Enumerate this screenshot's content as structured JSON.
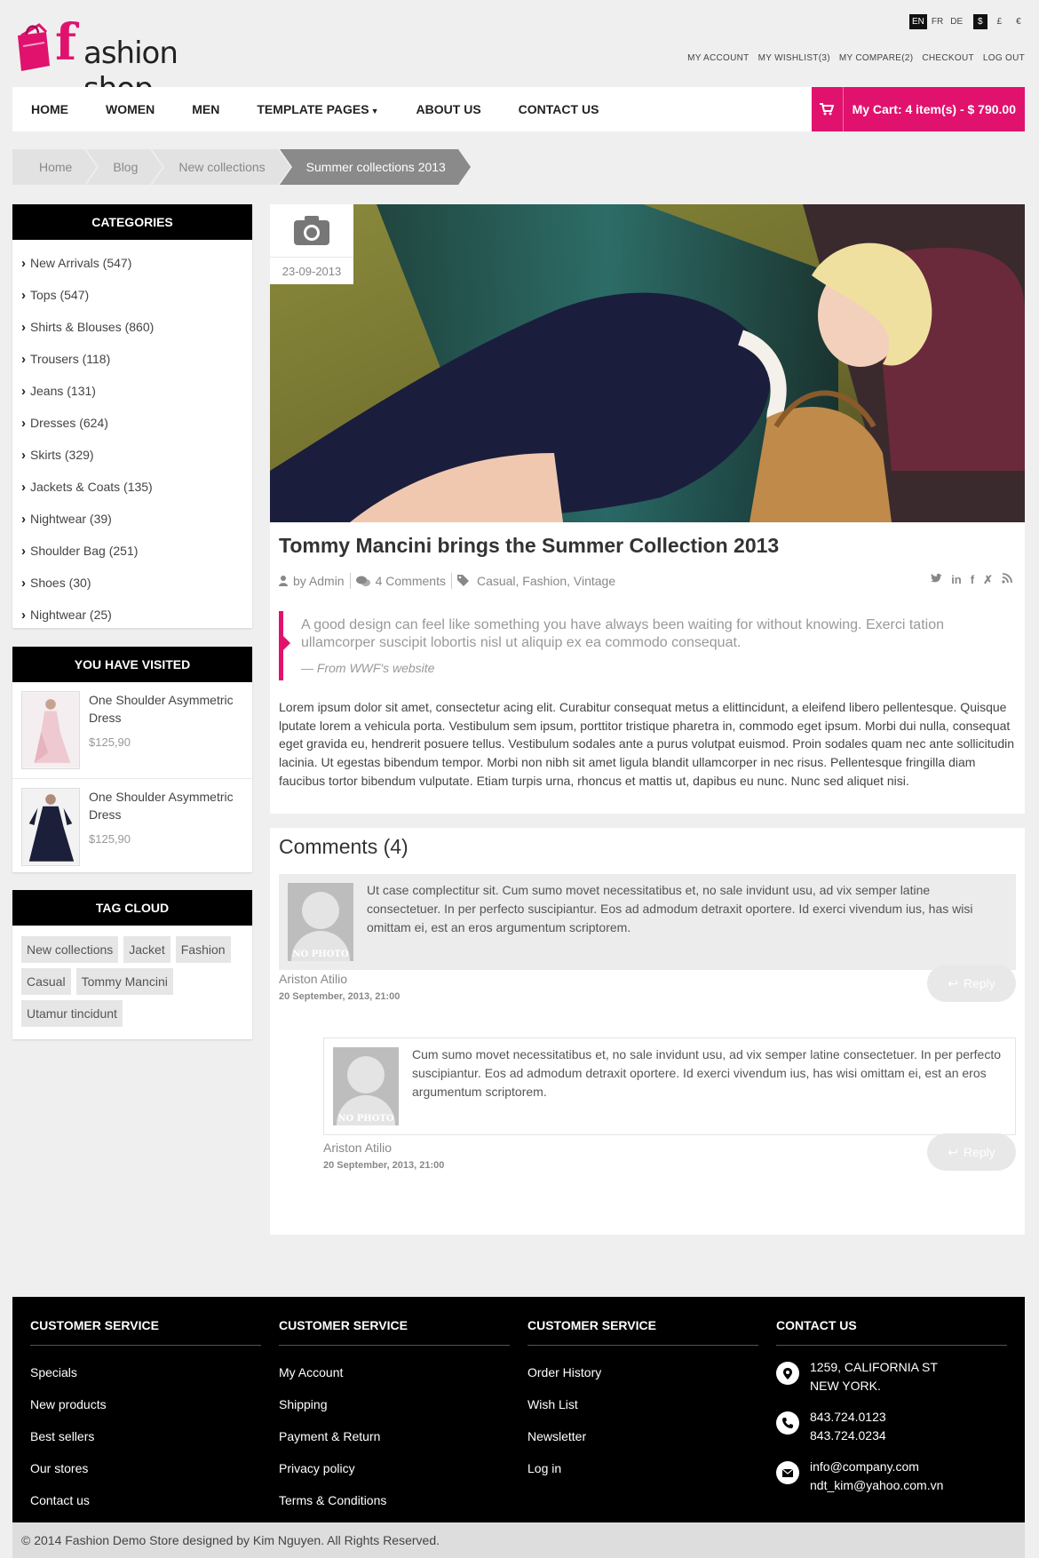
{
  "brand": {
    "logo_letter": "f",
    "logo_text": "ashion shop"
  },
  "languages": [
    "EN",
    "FR",
    "DE"
  ],
  "currencies": [
    "$",
    "£",
    "€"
  ],
  "top_links": [
    "MY ACCOUNT",
    "MY WISHLIST(3)",
    "MY COMPARE(2)",
    "CHECKOUT",
    "LOG OUT"
  ],
  "nav": {
    "items": [
      "HOME",
      "WOMEN",
      "MEN",
      "TEMPLATE PAGES",
      "ABOUT US",
      "CONTACT US"
    ],
    "cart_label": "My Cart: 4 item(s) - $ 790.00"
  },
  "breadcrumb": [
    "Home",
    "Blog",
    "New collections",
    "Summer collections 2013"
  ],
  "categories": {
    "title": "CATEGORIES",
    "items": [
      "New Arrivals (547)",
      "Tops (547)",
      "Shirts & Blouses (860)",
      "Trousers (118)",
      "Jeans (131)",
      "Dresses (624)",
      "Skirts (329)",
      "Jackets & Coats (135)",
      "Nightwear (39)",
      "Shoulder Bag (251)",
      "Shoes (30)",
      "Nightwear (25)"
    ]
  },
  "visited": {
    "title": "YOU HAVE VISITED",
    "items": [
      {
        "name": "One Shoulder Asymmetric Dress",
        "price": "$125,90"
      },
      {
        "name": "One Shoulder Asymmetric Dress",
        "price": "$125,90"
      }
    ]
  },
  "tag_cloud": {
    "title": "TAG CLOUD",
    "tags": [
      "New collections",
      "Jacket",
      "Fashion",
      "Casual",
      "Tommy Mancini",
      "Utamur tincidunt"
    ]
  },
  "post": {
    "date": "23-09-2013",
    "title": "Tommy Mancini brings the Summer Collection 2013",
    "author": "by Admin",
    "comments": "4 Comments",
    "tags": "Casual, Fashion, Vintage",
    "share_icons": [
      "twitter-icon",
      "linkedin-icon",
      "facebook-icon",
      "xing-icon",
      "rss-icon"
    ],
    "quote": "A good design can feel like something you have always been waiting for without knowing. Exerci tation ullamcorper suscipit lobortis nisl ut aliquip ex ea commodo consequat.",
    "quote_source": "— From WWF's website",
    "body": "Lorem ipsum dolor sit amet, consectetur acing elit. Curabitur consequat metus a elittincidunt, a eleifend libero pellentesque. Quisque lputate lorem a vehicula porta. Vestibulum sem ipsum, porttitor tristique pharetra in, commodo eget ipsum. Morbi dui nulla, consequat eget gravida eu, hendrerit posuere tellus. Vestibulum sodales ante a purus volutpat euismod. Proin sodales quam nec ante sollicitudin lacinia. Ut egestas bibendum tempor. Morbi non nibh sit amet ligula blandit ullamcorper in nec risus. Pellentesque fringilla diam faucibus tortor bibendum vulputate. Etiam turpis urna, rhoncus et mattis ut, dapibus eu nunc. Nunc sed aliquet nisi."
  },
  "comments": {
    "title": "Comments (4)",
    "no_photo": "NO PHOTO",
    "reply_label": "Reply",
    "items": [
      {
        "text": "Ut case complectitur sit. Cum sumo movet necessitatibus et, no sale invidunt usu, ad vix semper latine consectetuer. In per perfecto suscipiantur. Eos ad admodum detraxit oportere. Id exerci vivendum ius, has wisi omittam ei, est an eros argumentum scriptorem.",
        "author": "Ariston Atilio",
        "date": "20 September, 2013, 21:00"
      },
      {
        "text": "Cum sumo movet necessitatibus et, no sale invidunt usu, ad vix semper latine consectetuer. In per perfecto suscipiantur. Eos ad admodum detraxit oportere. Id exerci vivendum ius, has wisi omittam ei, est an eros argumentum scriptorem.",
        "author": "Ariston Atilio",
        "date": "20 September, 2013, 21:00"
      }
    ]
  },
  "footer": {
    "col1": {
      "title": "CUSTOMER SERVICE",
      "links": [
        "Specials",
        "New products",
        "Best sellers",
        "Our stores",
        "Contact us"
      ]
    },
    "col2": {
      "title": "CUSTOMER SERVICE",
      "links": [
        "My Account",
        "Shipping",
        "Payment & Return",
        "Privacy policy",
        "Terms & Conditions"
      ]
    },
    "col3": {
      "title": "CUSTOMER SERVICE",
      "links": [
        "Order History",
        "Wish List",
        "Newsletter",
        "Log in"
      ]
    },
    "contact": {
      "title": "CONTACT US",
      "address": [
        "1259, CALIFORNIA ST",
        "NEW YORK."
      ],
      "phones": [
        "843.724.0123",
        "843.724.0234"
      ],
      "emails": [
        "info@company.com",
        "ndt_kim@yahoo.com.vn"
      ]
    },
    "copyright": "© 2014 Fashion Demo Store designed by Kim Nguyen. All Rights Reserved."
  },
  "colors": {
    "accent": "#e0126d",
    "dark": "#000000",
    "page_bg": "#efefef"
  }
}
